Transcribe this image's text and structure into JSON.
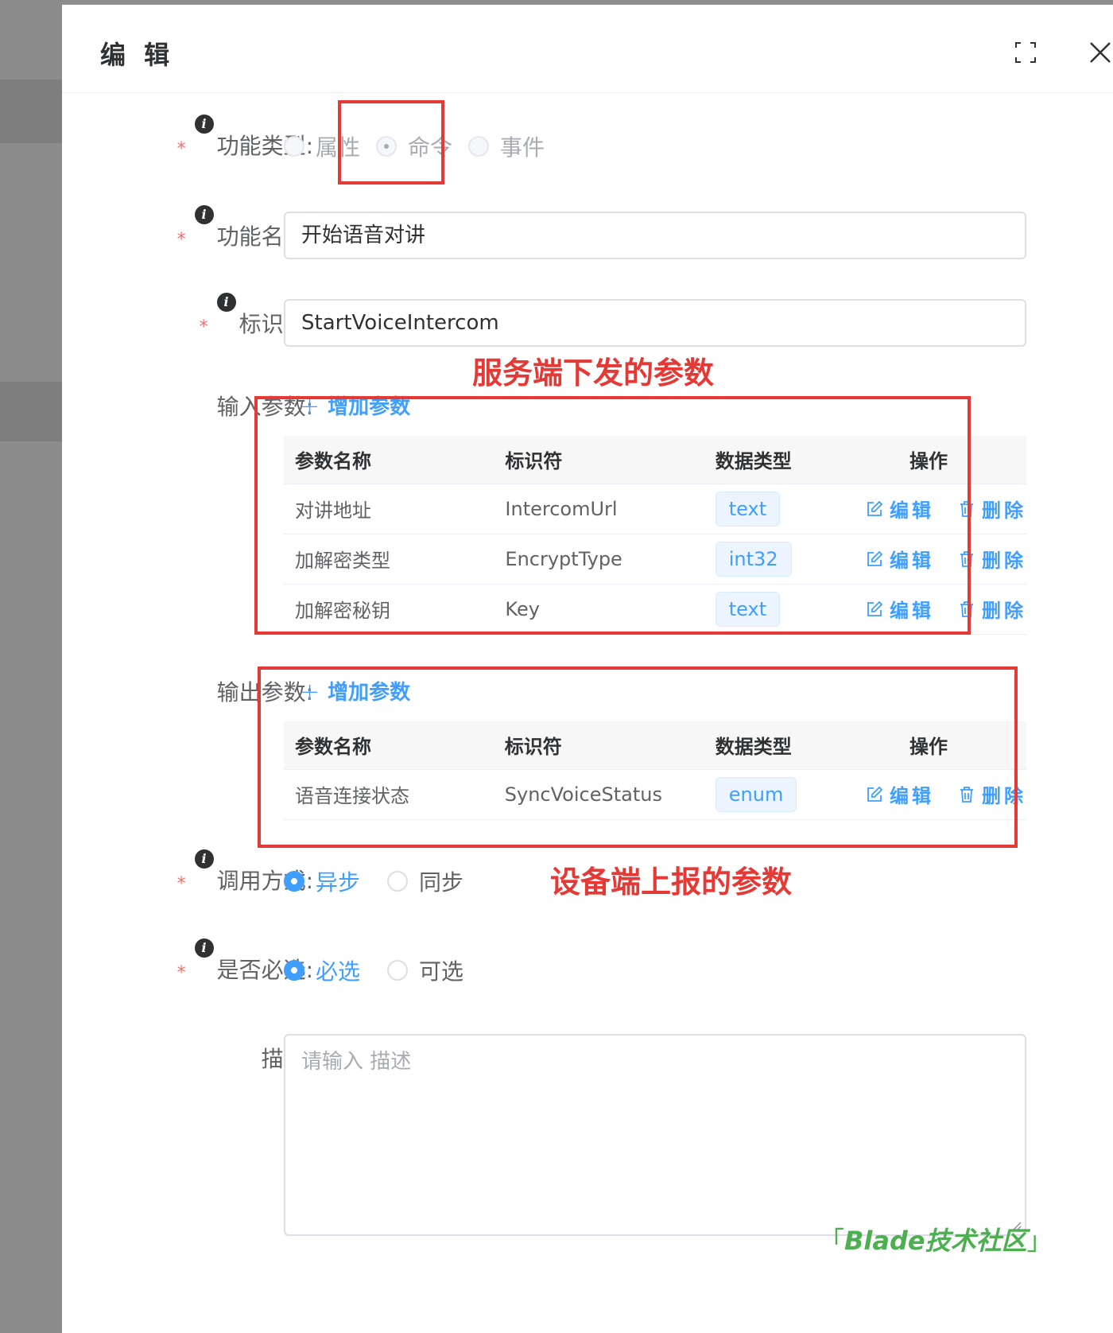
{
  "dialog": {
    "title": "编 辑",
    "fullscreen_icon": "fullscreen-icon",
    "close_icon": "close-icon"
  },
  "form": {
    "func_type": {
      "label": "功能类型:",
      "options": [
        "属性",
        "命令",
        "事件"
      ],
      "selected": "命令",
      "disabled": true
    },
    "func_name": {
      "label": "功能名称:",
      "value": "开始语音对讲"
    },
    "identifier": {
      "label": "标识符:",
      "value": "StartVoiceIntercom"
    },
    "input_params": {
      "label": "输入参数:",
      "add_label": "增加参数",
      "columns": [
        "参数名称",
        "标识符",
        "数据类型",
        "操作"
      ],
      "rows": [
        {
          "name": "对讲地址",
          "identifier": "IntercomUrl",
          "type": "text"
        },
        {
          "name": "加解密类型",
          "identifier": "EncryptType",
          "type": "int32"
        },
        {
          "name": "加解密秘钥",
          "identifier": "Key",
          "type": "text"
        }
      ],
      "edit_label": "编辑",
      "delete_label": "删除"
    },
    "output_params": {
      "label": "输出参数:",
      "add_label": "增加参数",
      "columns": [
        "参数名称",
        "标识符",
        "数据类型",
        "操作"
      ],
      "rows": [
        {
          "name": "语音连接状态",
          "identifier": "SyncVoiceStatus",
          "type": "enum"
        }
      ],
      "edit_label": "编辑",
      "delete_label": "删除"
    },
    "call_mode": {
      "label": "调用方式:",
      "options": [
        "异步",
        "同步"
      ],
      "selected": "异步"
    },
    "required": {
      "label": "是否必选:",
      "options": [
        "必选",
        "可选"
      ],
      "selected": "必选"
    },
    "description": {
      "label": "描述:",
      "placeholder": "请输入 描述"
    }
  },
  "annotations": {
    "input_note": "服务端下发的参数",
    "output_note": "设备端上报的参数",
    "color": "#e53935"
  },
  "watermark": {
    "text": "Blade技术社区"
  },
  "colors": {
    "primary": "#409eff",
    "required": "#f56c6c"
  }
}
